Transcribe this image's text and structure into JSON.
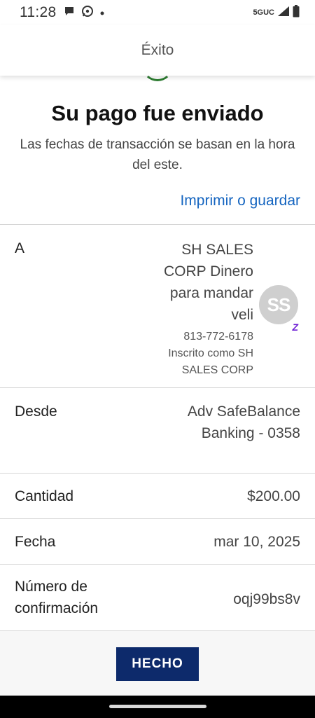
{
  "status_bar": {
    "time": "11:28",
    "network": "5GUC"
  },
  "header": {
    "title": "Éxito"
  },
  "result": {
    "title": "Su pago fue enviado",
    "subtitle": "Las fechas de transacción se basan en la hora del este.",
    "print_link": "Imprimir o guardar"
  },
  "details": {
    "to": {
      "label": "A",
      "name_lines": [
        "SH SALES",
        "CORP Dinero",
        "para mandar",
        "veli"
      ],
      "phone": "813-772-6178",
      "enrolled_lines": [
        "Inscrito como SH",
        "SALES CORP"
      ],
      "avatar_initials": "SS",
      "badge": "Z"
    },
    "from": {
      "label": "Desde",
      "value_lines": [
        "Adv SafeBalance",
        "Banking - 0358"
      ]
    },
    "amount": {
      "label": "Cantidad",
      "value": "$200.00"
    },
    "date": {
      "label": "Fecha",
      "value": "mar 10, 2025"
    },
    "confirmation": {
      "label_lines": [
        "Número de",
        "confirmación"
      ],
      "value": "oqj99bs8v"
    }
  },
  "footer": {
    "done_label": "HECHO"
  },
  "colors": {
    "accent_link": "#1565c0",
    "button_bg": "#0d2a6b",
    "success": "#2e7d32",
    "zelle": "#6d1ed4"
  }
}
